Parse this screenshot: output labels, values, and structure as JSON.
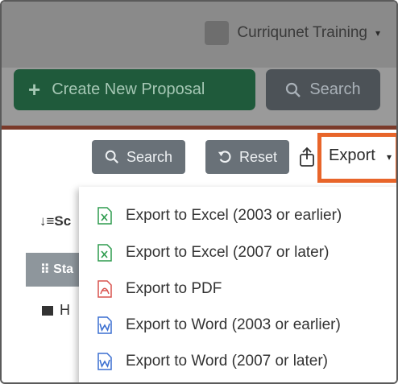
{
  "header": {
    "user_name": "Curriqunet Training",
    "user_caret": "▾"
  },
  "toolbar": {
    "create_label": "Create New Proposal",
    "create_icon": "plus-icon",
    "search_label": "Search"
  },
  "filters": {
    "search_label": "Search",
    "reset_label": "Reset",
    "export_label": "Export",
    "export_caret": "▾"
  },
  "background": {
    "sort_label": "Sc",
    "status_label": "Sta",
    "h_label": "H"
  },
  "export_menu": {
    "items": [
      {
        "label": "Export to Excel (2003 or earlier)",
        "icon": "excel-icon",
        "color": "#2e9b4e"
      },
      {
        "label": "Export to Excel (2007 or later)",
        "icon": "excel-icon",
        "color": "#2e9b4e"
      },
      {
        "label": "Export to PDF",
        "icon": "pdf-icon",
        "color": "#d9534f"
      },
      {
        "label": "Export to Word (2003 or earlier)",
        "icon": "word-icon",
        "color": "#3b6fd1"
      },
      {
        "label": "Export to Word (2007 or later)",
        "icon": "word-icon",
        "color": "#3b6fd1"
      }
    ]
  },
  "colors": {
    "highlight": "#e8652a",
    "create_button": "#1f5a3b",
    "secondary_button": "#697178"
  }
}
